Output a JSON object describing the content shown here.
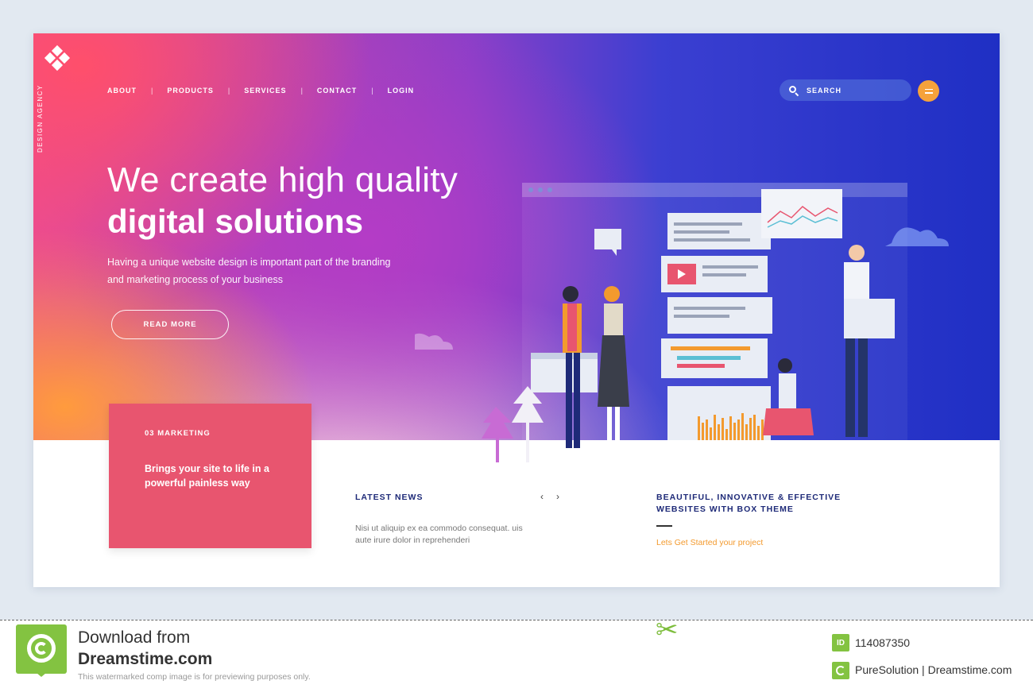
{
  "brand": {
    "vertical_text": "DESIGN AGENCY",
    "logo_icon": "diamond-cluster-logo"
  },
  "nav": {
    "items": [
      "ABOUT",
      "PRODUCTS",
      "SERVICES",
      "CONTACT",
      "LOGIN"
    ]
  },
  "search": {
    "placeholder": "SEARCH"
  },
  "hero": {
    "headline_light": "We create high quality",
    "headline_bold": "digital solutions",
    "subtext": "Having a unique website design is important part of the branding and marketing process of your business",
    "cta_label": "READ MORE"
  },
  "marketing": {
    "tag": "03 MARKETING",
    "description": "Brings your site to life in a powerful painless way"
  },
  "news": {
    "title": "LATEST NEWS",
    "prev_icon": "‹",
    "next_icon": "›",
    "body": "Nisi ut aliquip ex ea commodo consequat. uis aute irure dolor in reprehenderi"
  },
  "feature": {
    "title": "BEAUTIFUL, INNOVATIVE & EFFECTIVE WEBSITES WITH BOX THEME",
    "link": "Lets Get Started your project"
  },
  "footer": {
    "download_line1": "Download from",
    "download_line2": "Dreamstime.com",
    "note": "This watermarked comp image is for previewing purposes only.",
    "id_badge": "ID",
    "id_number": "114087350",
    "credit": "PureSolution | Dreamstime.com"
  },
  "colors": {
    "accent_pink": "#e8556f",
    "accent_orange": "#f5a23b",
    "navy_text": "#1e2a78",
    "dreamstime_green": "#83c341"
  }
}
